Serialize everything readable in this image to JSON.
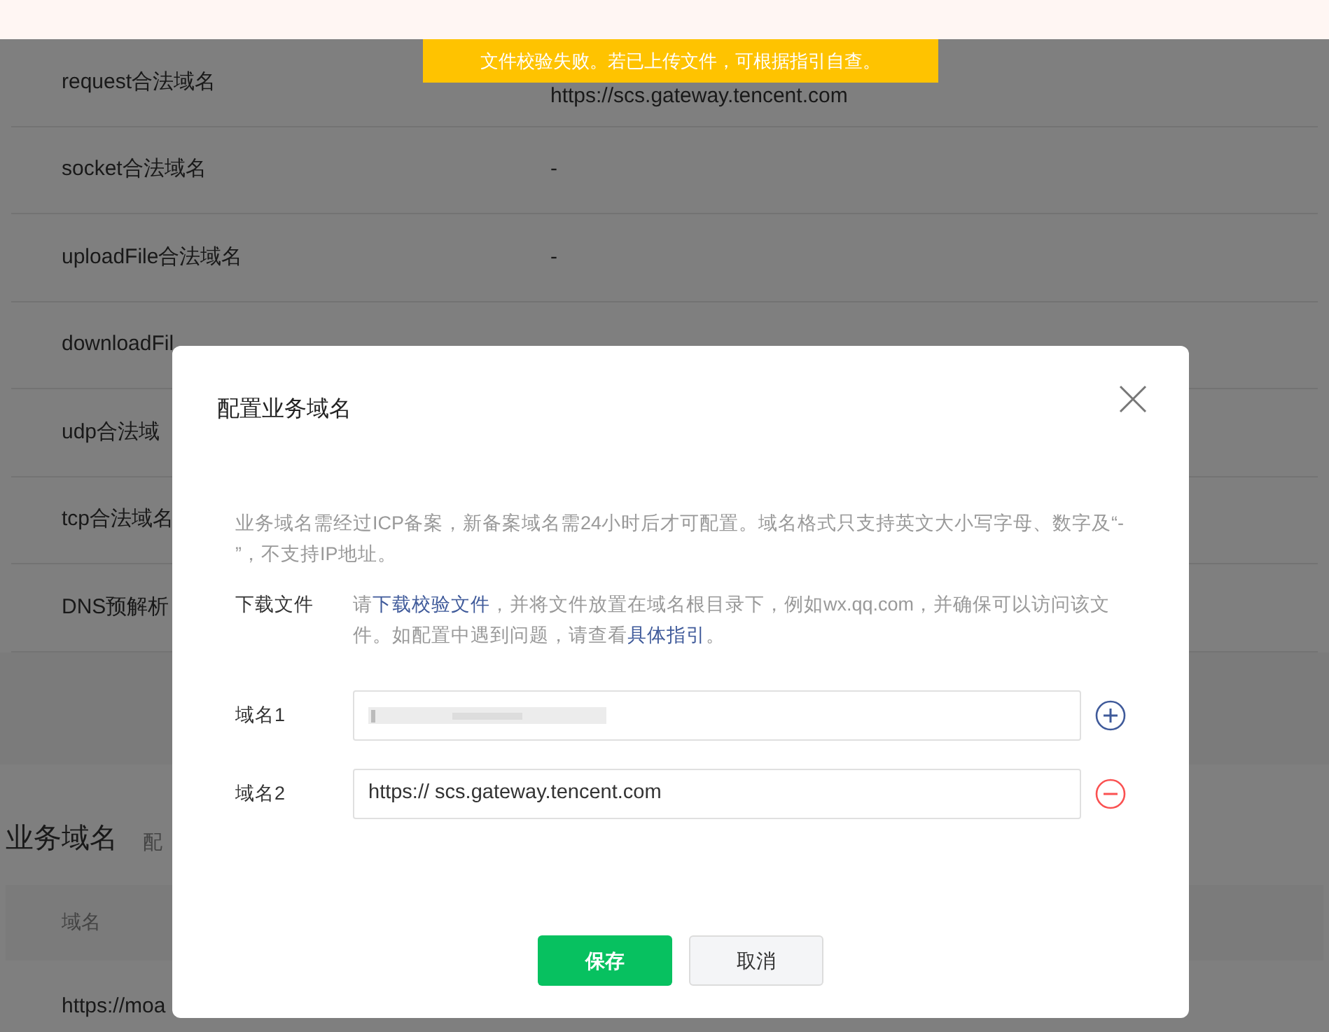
{
  "toast": {
    "text": "文件校验失败。若已上传文件，可根据指引自查。"
  },
  "background_table": {
    "rows": [
      {
        "label": "request合法域名",
        "value": "https://scs.gateway.tencent.com"
      },
      {
        "label": "socket合法域名",
        "value": "-"
      },
      {
        "label": "uploadFile合法域名",
        "value": "-"
      },
      {
        "label": "downloadFil"
      },
      {
        "label": "udp合法域"
      },
      {
        "label": "tcp合法域名"
      },
      {
        "label": "DNS预解析"
      }
    ]
  },
  "business_section": {
    "title": "业务域名",
    "subtitle": "配",
    "column_header": "域名",
    "row_1": "https://moa"
  },
  "dialog": {
    "title": "配置业务域名",
    "notice": "业务域名需经过ICP备案，新备案域名需24小时后才可配置。域名格式只支持英文大小写字母、数字及“- ”，不支持IP地址。",
    "download": {
      "label": "下载文件",
      "before": "请",
      "link1": "下载校验文件",
      "middle": "，并将文件放置在域名根目录下，例如wx.qq.com，并确保可以访问该文件。如配置中遇到问题，请查看",
      "link2": "具体指引",
      "after": "。"
    },
    "fields": [
      {
        "label": "域名1",
        "redacted": true,
        "kind": "add"
      },
      {
        "label": "域名2",
        "redacted": false,
        "value": "https:// scs.gateway.tencent.com",
        "kind": "remove"
      }
    ],
    "buttons": [
      {
        "label": "保存",
        "kind": "primary"
      },
      {
        "label": "取消",
        "kind": "secondary"
      }
    ]
  }
}
